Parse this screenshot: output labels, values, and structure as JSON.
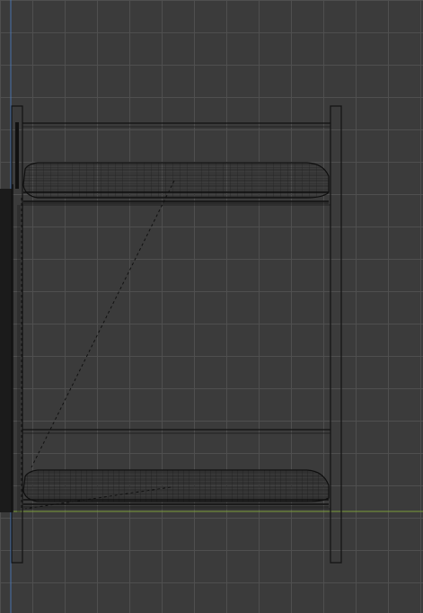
{
  "viewport": {
    "background_color": "#3b3b3b",
    "grid_color": "#505050",
    "axis_y_color": "#4a79b8",
    "axis_x_color": "#7fa33a",
    "wire_color": "#111111",
    "shadow_color": "#1b1b1b"
  },
  "model": {
    "icon": "wireframe-bunk-bed-icon",
    "parts": [
      "left-post",
      "right-post",
      "upper-bunk",
      "lower-bunk",
      "diagonal-ladder-guides"
    ]
  }
}
